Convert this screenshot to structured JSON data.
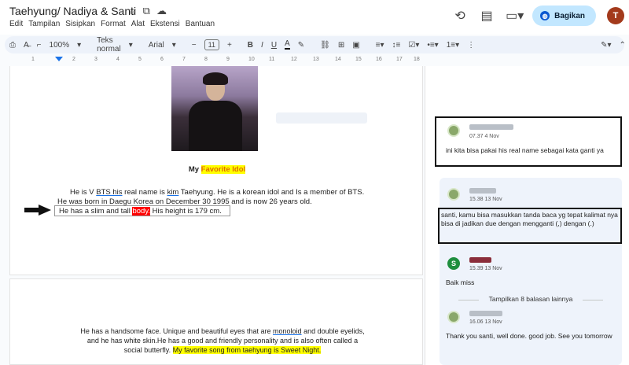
{
  "app": {
    "title": "Taehyung/ Nadiya & Santi",
    "menu": [
      "Edit",
      "Tampilan",
      "Sisipkan",
      "Format",
      "Alat",
      "Ekstensi",
      "Bantuan"
    ],
    "share_label": "Bagikan",
    "avatar_letter": "T"
  },
  "toolbar": {
    "zoom": "100%",
    "style": "Teks normal",
    "font": "Arial",
    "size": "11"
  },
  "ruler": [
    "1",
    "2",
    "3",
    "4",
    "5",
    "6",
    "7",
    "8",
    "9",
    "10",
    "11",
    "12",
    "13",
    "14",
    "15",
    "16",
    "17",
    "18"
  ],
  "doc": {
    "heading_prefix": "My ",
    "heading_highlight": "Favorite Idol",
    "p1_a": "He is V ",
    "p1_bts": "BTS his",
    "p1_b": " real name is ",
    "p1_kim": "kim",
    "p1_c": " Taehyung. He is a korean idol and Is a member of BTS.",
    "p1_line2": "He was born in Daegu Korea on December 30 1995 and is now 26 years old.",
    "p1_line3_a": "He has a slim and tall ",
    "p1_line3_red": "body.",
    "p1_line3_b": " His height is 179 cm.",
    "p2_line1_a": "He has a handsome face. Unique and beautiful eyes that are ",
    "p2_monoloid": "monoloid",
    "p2_line1_b": " and double eyelids,",
    "p2_line2": "and he has white skin.He has a good and friendly personality and is also often called a",
    "p2_line3_a": "social butterfly. ",
    "p2_line3_hl": "My favorite song from taehyung is Sweet Night."
  },
  "comments": [
    {
      "time": "07.37 4 Nov",
      "text": "ini kita bisa pakai his real name sebagai kata ganti ya"
    },
    {
      "time": "15.38 13 Nov",
      "text": "santi, kamu bisa masukkan tanda baca yg tepat kalimat nya bisa di jadikan due dengan mengganti (,) dengan (.)"
    },
    {
      "time": "15.39 13 Nov",
      "avatar": "S",
      "text": "Baik miss"
    },
    {
      "show_more": "Tampilkan 8 balasan lainnya"
    },
    {
      "time": "16.06 13 Nov",
      "text": "Thank you santi, well done. good job. See you tomorrow"
    }
  ]
}
